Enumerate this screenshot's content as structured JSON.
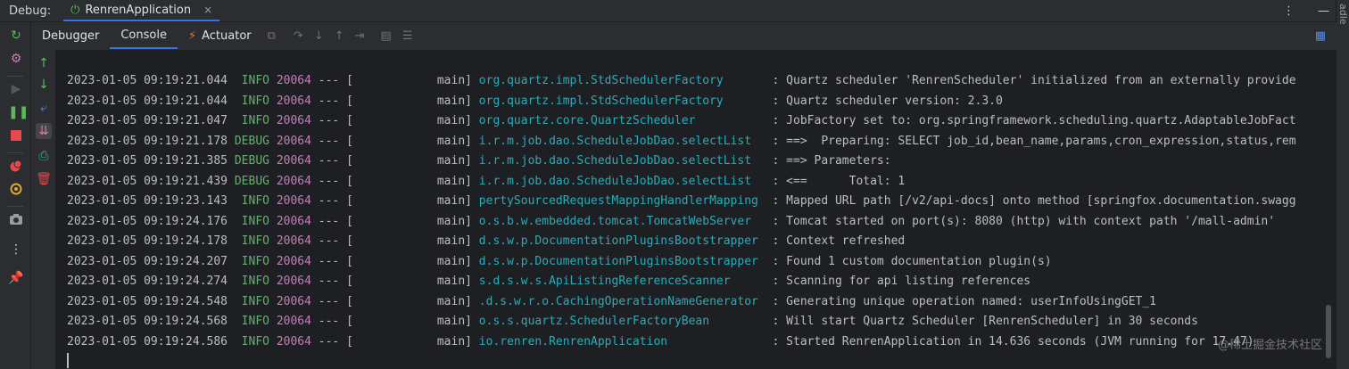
{
  "debugbar": {
    "label": "Debug:",
    "run_tab": "RenrenApplication",
    "close_glyph": "×",
    "more_glyph": "⋮",
    "minimize_glyph": "—"
  },
  "edge": {
    "label": "adle"
  },
  "tabs": [
    {
      "label": "Debugger",
      "active": false
    },
    {
      "label": "Console",
      "active": true
    },
    {
      "label": "Actuator",
      "active": false
    }
  ],
  "icons": {
    "rerun": "rerun-icon",
    "settings": "gear-icon",
    "resume": "resume-icon",
    "pause": "pause-icon",
    "stop": "stop-icon",
    "breakpoints": "breakpoints-icon",
    "mute": "mute-breakpoints-icon",
    "camera": "camera-icon",
    "more": "more-icon",
    "pin": "pin-icon",
    "actuator": "actuator-icon",
    "up": "up-arrow-icon",
    "down": "down-arrow-icon",
    "wrap": "soft-wrap-icon",
    "scroll": "scroll-to-end-icon",
    "print": "print-icon",
    "trash": "trash-icon",
    "layout": "layout-icon"
  },
  "colors": {
    "accent": "#3574f0",
    "info": "#6aab73",
    "pid": "#c77dbb",
    "logger": "#2aacb8",
    "stop": "#e5484d"
  },
  "log": [
    {
      "ts": "2023-01-05 09:19:21.044",
      "level": " INFO",
      "pid": "20064",
      "thread": " --- [            main] ",
      "logger": "org.quartz.impl.StdSchedulerFactory      ",
      "msg": " : Quartz scheduler 'RenrenScheduler' initialized from an externally provide"
    },
    {
      "ts": "2023-01-05 09:19:21.044",
      "level": " INFO",
      "pid": "20064",
      "thread": " --- [            main] ",
      "logger": "org.quartz.impl.StdSchedulerFactory      ",
      "msg": " : Quartz scheduler version: 2.3.0"
    },
    {
      "ts": "2023-01-05 09:19:21.047",
      "level": " INFO",
      "pid": "20064",
      "thread": " --- [            main] ",
      "logger": "org.quartz.core.QuartzScheduler          ",
      "msg": " : JobFactory set to: org.springframework.scheduling.quartz.AdaptableJobFact"
    },
    {
      "ts": "2023-01-05 09:19:21.178",
      "level": "DEBUG",
      "pid": "20064",
      "thread": " --- [            main] ",
      "logger": "i.r.m.job.dao.ScheduleJobDao.selectList  ",
      "msg": " : ==>  Preparing: SELECT job_id,bean_name,params,cron_expression,status,rem"
    },
    {
      "ts": "2023-01-05 09:19:21.385",
      "level": "DEBUG",
      "pid": "20064",
      "thread": " --- [            main] ",
      "logger": "i.r.m.job.dao.ScheduleJobDao.selectList  ",
      "msg": " : ==> Parameters:"
    },
    {
      "ts": "2023-01-05 09:19:21.439",
      "level": "DEBUG",
      "pid": "20064",
      "thread": " --- [            main] ",
      "logger": "i.r.m.job.dao.ScheduleJobDao.selectList  ",
      "msg": " : <==      Total: 1"
    },
    {
      "ts": "2023-01-05 09:19:23.143",
      "level": " INFO",
      "pid": "20064",
      "thread": " --- [            main] ",
      "logger": "pertySourcedRequestMappingHandlerMapping ",
      "msg": " : Mapped URL path [/v2/api-docs] onto method [springfox.documentation.swagg"
    },
    {
      "ts": "2023-01-05 09:19:24.176",
      "level": " INFO",
      "pid": "20064",
      "thread": " --- [            main] ",
      "logger": "o.s.b.w.embedded.tomcat.TomcatWebServer  ",
      "msg": " : Tomcat started on port(s): 8080 (http) with context path '/mall-admin'"
    },
    {
      "ts": "2023-01-05 09:19:24.178",
      "level": " INFO",
      "pid": "20064",
      "thread": " --- [            main] ",
      "logger": "d.s.w.p.DocumentationPluginsBootstrapper ",
      "msg": " : Context refreshed"
    },
    {
      "ts": "2023-01-05 09:19:24.207",
      "level": " INFO",
      "pid": "20064",
      "thread": " --- [            main] ",
      "logger": "d.s.w.p.DocumentationPluginsBootstrapper ",
      "msg": " : Found 1 custom documentation plugin(s)"
    },
    {
      "ts": "2023-01-05 09:19:24.274",
      "level": " INFO",
      "pid": "20064",
      "thread": " --- [            main] ",
      "logger": "s.d.s.w.s.ApiListingReferenceScanner     ",
      "msg": " : Scanning for api listing references"
    },
    {
      "ts": "2023-01-05 09:19:24.548",
      "level": " INFO",
      "pid": "20064",
      "thread": " --- [            main] ",
      "logger": ".d.s.w.r.o.CachingOperationNameGenerator ",
      "msg": " : Generating unique operation named: userInfoUsingGET_1"
    },
    {
      "ts": "2023-01-05 09:19:24.568",
      "level": " INFO",
      "pid": "20064",
      "thread": " --- [            main] ",
      "logger": "o.s.s.quartz.SchedulerFactoryBean        ",
      "msg": " : Will start Quartz Scheduler [RenrenScheduler] in 30 seconds"
    },
    {
      "ts": "2023-01-05 09:19:24.586",
      "level": " INFO",
      "pid": "20064",
      "thread": " --- [            main] ",
      "logger": "io.renren.RenrenApplication              ",
      "msg": " : Started RenrenApplication in 14.636 seconds (JVM running for 17.47)"
    }
  ],
  "watermark": "@稀土掘金技术社区"
}
